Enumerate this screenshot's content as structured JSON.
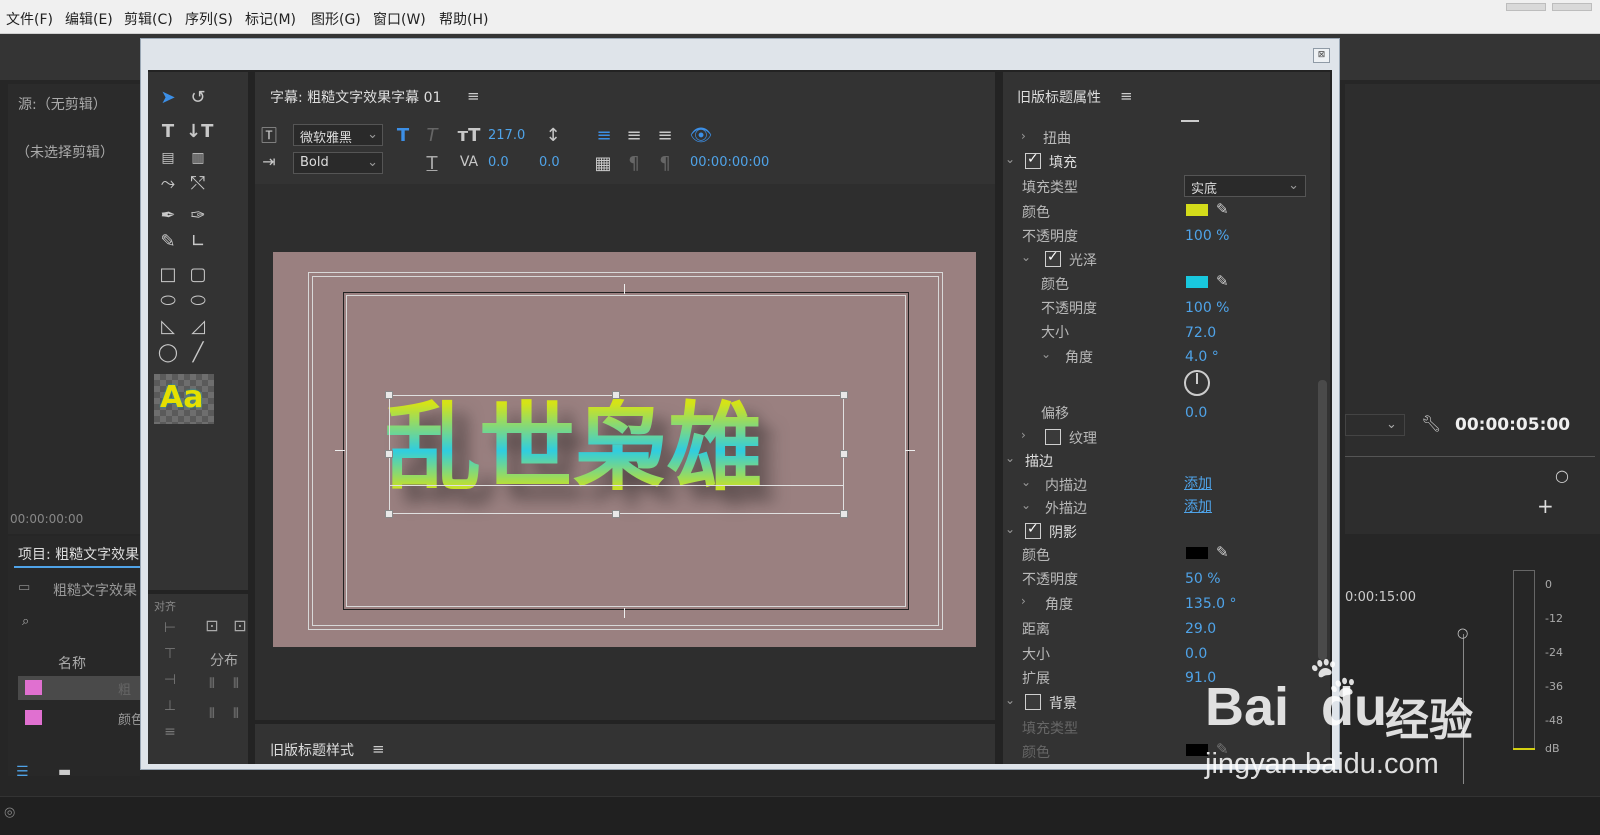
{
  "menu": [
    "文件(F)",
    "编辑(E)",
    "剪辑(C)",
    "序列(S)",
    "标记(M)",
    "图形(G)",
    "窗口(W)",
    "帮助(H)"
  ],
  "source_panel": {
    "title": "源:（无剪辑）",
    "subtitle": "（未选择剪辑）",
    "timecode": "00:00:00:00"
  },
  "project_panel": {
    "title": "项目: 粗糙文字效果",
    "folder": "粗糙文字效果",
    "col_name": "名称",
    "item1": "粗",
    "item2": "颜色"
  },
  "program": {
    "timecode": "00:00:05:00",
    "ruler_time": "0:00:15:00"
  },
  "meter": {
    "labels": [
      "0",
      "-12",
      "-24",
      "-36",
      "-48",
      "dB"
    ]
  },
  "dialog_close": "⊠",
  "title_panel": {
    "header": "字幕: 粗糙文字效果字幕 01",
    "font": "微软雅黑",
    "style": "Bold",
    "font_size": "217.0",
    "tracking": "0.0",
    "kerning": "0.0",
    "timecode": "00:00:00:00"
  },
  "canvas_text": "乱世枭雄",
  "styles_panel": {
    "header": "旧版标题样式"
  },
  "align_panel": {
    "label": "对齐",
    "distribute": "分布"
  },
  "aa_label": "Aa",
  "props": {
    "header": "旧版标题属性",
    "distort": "扭曲",
    "fill": "填充",
    "fill_type_label": "填充类型",
    "fill_type": "实底",
    "color_label": "颜色",
    "opacity_label": "不透明度",
    "fill_opacity": "100 %",
    "sheen": "光泽",
    "sheen_color_label": "颜色",
    "sheen_opacity_label": "不透明度",
    "sheen_opacity": "100 %",
    "size_label": "大小",
    "sheen_size": "72.0",
    "angle_label": "角度",
    "sheen_angle": "4.0 °",
    "offset_label": "偏移",
    "sheen_offset": "0.0",
    "texture": "纹理",
    "stroke": "描边",
    "inner_stroke": "内描边",
    "outer_stroke": "外描边",
    "add": "添加",
    "shadow": "阴影",
    "shadow_color_label": "颜色",
    "shadow_opacity_label": "不透明度",
    "shadow_opacity": "50 %",
    "shadow_angle_label": "角度",
    "shadow_angle": "135.0 °",
    "distance_label": "距离",
    "distance": "29.0",
    "shadow_size_label": "大小",
    "shadow_size": "0.0",
    "spread_label": "扩展",
    "spread": "91.0",
    "background": "背景",
    "bg_fill_type_label": "填充类型",
    "bg_color_label": "颜色"
  },
  "colors": {
    "fill": "#d4dc1a",
    "sheen": "#19c8de",
    "shadow": "#000000",
    "accent": "#4fa3e8"
  },
  "watermark": {
    "brand": "Bai",
    "brand2": "du",
    "cn": "经验",
    "url": "jingyan.baidu.com"
  }
}
